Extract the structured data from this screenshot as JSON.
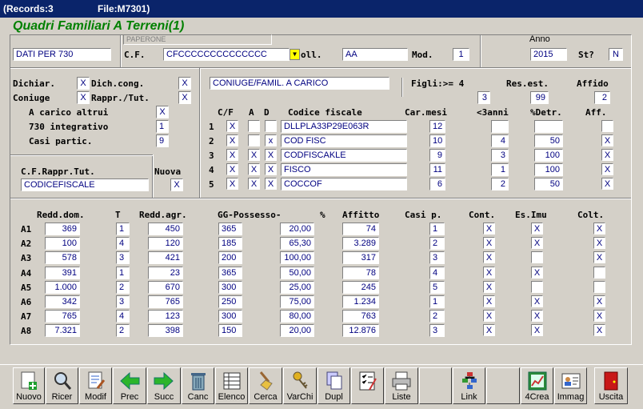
{
  "window": {
    "records": "(Records:3",
    "file": "File:M7301)"
  },
  "form_title": "Quadri Familiari  A Terreni(1)",
  "header": {
    "paperone": "PAPERONE",
    "dati": "DATI PER 730",
    "cf_label": "C.F.",
    "cf_value": "CFCCCCCCCCCCCCCC",
    "oll_label": "oll.",
    "oll_value": "AA",
    "mod_label": "Mod.",
    "mod_value": "1",
    "anno_label": "Anno",
    "anno_value": "2015",
    "st_label": "St?",
    "st_value": "N"
  },
  "left": {
    "dichiar_label": "Dichiar.",
    "dichiar_value": "X",
    "dichcong_label": "Dich.cong.",
    "dichcong_value": "X",
    "coniuge_label": "Coniuge",
    "coniuge_value": "X",
    "rappr_label": "Rappr./Tut.",
    "rappr_value": "X",
    "acarico_label": "A carico altrui",
    "acarico_value": "X",
    "int730_label": "730 integrativo",
    "int730_value": "1",
    "casi_label": "Casi partic.",
    "casi_value": "9",
    "cfrappr_label": "C.F.Rappr.Tut.",
    "cfrappr_value": "CODICEFISCALE",
    "nuova_label": "Nuova",
    "nuova_value": "X"
  },
  "family": {
    "coniuge_fam": "CONIUGE/FAMIL. A CARICO",
    "figli_label": "Figli:>= 4",
    "figli_value": "3",
    "resest_label": "Res.est.",
    "resest_value": "99",
    "affido_label": "Affido",
    "affido_value": "2",
    "columns": [
      "C/F",
      "A",
      "D",
      "Codice fiscale",
      "Car.mesi",
      "<3anni",
      "%Detr.",
      "Aff."
    ],
    "rows": [
      {
        "n": "1",
        "cf": "X",
        "a": "",
        "d": "",
        "codice": "DLLPLA33P29E063R",
        "mesi": "12",
        "anni": "",
        "detr": "",
        "aff": ""
      },
      {
        "n": "2",
        "cf": "X",
        "a": "",
        "d": "x",
        "codice": "COD FISC",
        "mesi": "10",
        "anni": "4",
        "detr": "50",
        "aff": "X"
      },
      {
        "n": "3",
        "cf": "X",
        "a": "X",
        "d": "X",
        "codice": "CODFISCAKLE",
        "mesi": "9",
        "anni": "3",
        "detr": "100",
        "aff": "X"
      },
      {
        "n": "4",
        "cf": "X",
        "a": "X",
        "d": "X",
        "codice": "FISCO",
        "mesi": "11",
        "anni": "1",
        "detr": "100",
        "aff": "X"
      },
      {
        "n": "5",
        "cf": "X",
        "a": "X",
        "d": "X",
        "codice": "COCCOF",
        "mesi": "6",
        "anni": "2",
        "detr": "50",
        "aff": "X"
      }
    ]
  },
  "terreni": {
    "columns": [
      "Redd.dom.",
      "T",
      "Redd.agr.",
      "GG-Possesso-",
      "%",
      "Affitto",
      "Casi p.",
      "Cont.",
      "Es.Imu",
      "Colt."
    ],
    "rows": [
      {
        "id": "A1",
        "redd": "369",
        "t": "1",
        "agr": "450",
        "gg": "365",
        "perc": "20,00",
        "affitto": "74",
        "casi": "1",
        "cont": "X",
        "imu": "X",
        "colt": "X"
      },
      {
        "id": "A2",
        "redd": "100",
        "t": "4",
        "agr": "120",
        "gg": "185",
        "perc": "65,30",
        "affitto": "3.289",
        "casi": "2",
        "cont": "X",
        "imu": "X",
        "colt": "X"
      },
      {
        "id": "A3",
        "redd": "578",
        "t": "3",
        "agr": "421",
        "gg": "200",
        "perc": "100,00",
        "affitto": "317",
        "casi": "3",
        "cont": "X",
        "imu": "",
        "colt": "X"
      },
      {
        "id": "A4",
        "redd": "391",
        "t": "1",
        "agr": "23",
        "gg": "365",
        "perc": "50,00",
        "affitto": "78",
        "casi": "4",
        "cont": "X",
        "imu": "X",
        "colt": ""
      },
      {
        "id": "A5",
        "redd": "1.000",
        "t": "2",
        "agr": "670",
        "gg": "300",
        "perc": "25,00",
        "affitto": "245",
        "casi": "5",
        "cont": "X",
        "imu": "",
        "colt": ""
      },
      {
        "id": "A6",
        "redd": "342",
        "t": "3",
        "agr": "765",
        "gg": "250",
        "perc": "75,00",
        "affitto": "1.234",
        "casi": "1",
        "cont": "X",
        "imu": "X",
        "colt": "X"
      },
      {
        "id": "A7",
        "redd": "765",
        "t": "4",
        "agr": "123",
        "gg": "300",
        "perc": "80,00",
        "affitto": "763",
        "casi": "2",
        "cont": "X",
        "imu": "X",
        "colt": "X"
      },
      {
        "id": "A8",
        "redd": "7.321",
        "t": "2",
        "agr": "398",
        "gg": "150",
        "perc": "20,00",
        "affitto": "12.876",
        "casi": "3",
        "cont": "X",
        "imu": "X",
        "colt": "X"
      }
    ]
  },
  "toolbar": [
    {
      "label": "Nuovo",
      "icon": "new-document-icon"
    },
    {
      "label": "Ricer",
      "icon": "magnifier-icon"
    },
    {
      "label": "Modif",
      "icon": "edit-document-icon"
    },
    {
      "label": "Prec",
      "icon": "arrow-left-icon"
    },
    {
      "label": "Succ",
      "icon": "arrow-right-icon"
    },
    {
      "label": "Canc",
      "icon": "trash-icon"
    },
    {
      "label": "Elenco",
      "icon": "list-table-icon"
    },
    {
      "label": "Cerca",
      "icon": "broom-icon"
    },
    {
      "label": "VarChi",
      "icon": "keys-icon"
    },
    {
      "label": "Dupl",
      "icon": "duplicate-icon"
    },
    {
      "label": "",
      "icon": "checklist-icon"
    },
    {
      "label": "Liste",
      "icon": "printer-icon"
    },
    {
      "label": "",
      "icon": ""
    },
    {
      "label": "Link",
      "icon": "link-tree-icon"
    },
    {
      "label": "",
      "icon": ""
    },
    {
      "label": "4Crea",
      "icon": "create-chart-icon"
    },
    {
      "label": "Immag",
      "icon": "id-card-icon"
    },
    {
      "label": "Uscita",
      "icon": "exit-door-icon"
    }
  ]
}
